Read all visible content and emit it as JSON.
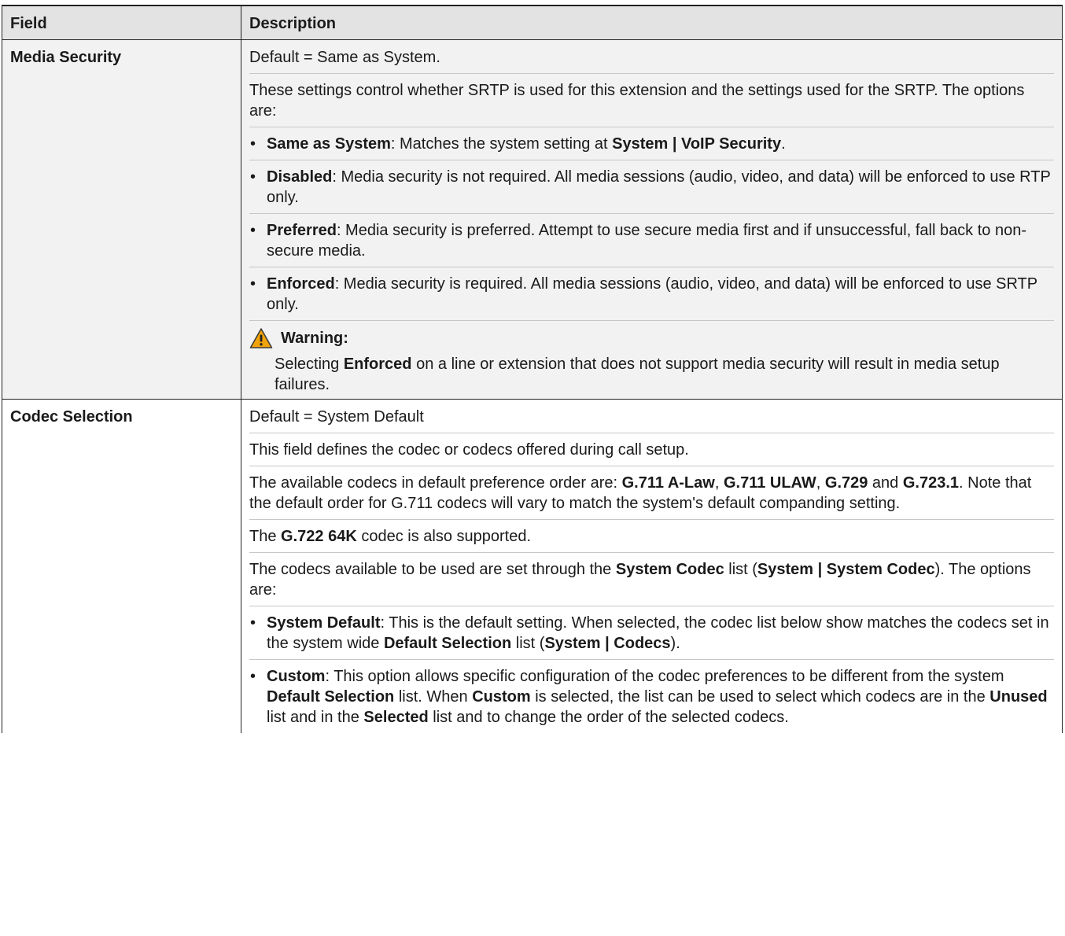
{
  "header": {
    "field": "Field",
    "description": "Description"
  },
  "rows": [
    {
      "field": "Media Security",
      "paras": [
        [
          {
            "t": "Default = Same as System."
          }
        ],
        [
          {
            "t": "These settings control whether SRTP is used for this extension and the settings used for the SRTP. The options are:"
          }
        ]
      ],
      "bullets": [
        [
          {
            "t": "Same as System",
            "b": true
          },
          {
            "t": ": Matches the system setting at "
          },
          {
            "t": "System | VoIP Security",
            "b": true
          },
          {
            "t": "."
          }
        ],
        [
          {
            "t": "Disabled",
            "b": true
          },
          {
            "t": ": Media security is not required. All media sessions (audio, video, and data) will be enforced to use RTP only."
          }
        ],
        [
          {
            "t": "Preferred",
            "b": true
          },
          {
            "t": ": Media security is preferred. Attempt to use secure media first and if unsuccessful, fall back to non-secure media."
          }
        ],
        [
          {
            "t": "Enforced",
            "b": true
          },
          {
            "t": ": Media security is required. All media sessions (audio, video, and data) will be enforced to use SRTP only."
          }
        ]
      ],
      "warning": {
        "title": "Warning:",
        "body": [
          {
            "t": "Selecting "
          },
          {
            "t": "Enforced",
            "b": true
          },
          {
            "t": " on a line or extension that does not support media security will result in media setup failures."
          }
        ]
      }
    },
    {
      "field": "Codec Selection",
      "paras": [
        [
          {
            "t": "Default = System Default"
          }
        ],
        [
          {
            "t": "This field defines the codec or codecs offered during call setup."
          }
        ],
        [
          {
            "t": "The available codecs in default preference order are: "
          },
          {
            "t": "G.711 A-Law",
            "b": true
          },
          {
            "t": ", "
          },
          {
            "t": "G.711 ULAW",
            "b": true
          },
          {
            "t": ", "
          },
          {
            "t": "G.729",
            "b": true
          },
          {
            "t": " and "
          },
          {
            "t": "G.723.1",
            "b": true
          },
          {
            "t": ". Note that the default order for G.711 codecs will vary to match the system's default companding setting."
          }
        ],
        [
          {
            "t": "The "
          },
          {
            "t": "G.722 64K",
            "b": true
          },
          {
            "t": " codec is also supported."
          }
        ],
        [
          {
            "t": "The codecs available to be used are set through the "
          },
          {
            "t": "System Codec",
            "b": true
          },
          {
            "t": " list ("
          },
          {
            "t": "System | System Codec",
            "b": true
          },
          {
            "t": "). The options are:"
          }
        ]
      ],
      "bullets": [
        [
          {
            "t": "System Default",
            "b": true
          },
          {
            "t": ": This is the default setting. When selected, the codec list below show matches the codecs set in the system wide "
          },
          {
            "t": "Default Selection",
            "b": true
          },
          {
            "t": " list ("
          },
          {
            "t": "System | Codecs",
            "b": true
          },
          {
            "t": ")."
          }
        ],
        [
          {
            "t": "Custom",
            "b": true
          },
          {
            "t": ": This option allows specific configuration of the codec preferences to be different from the system "
          },
          {
            "t": "Default Selection",
            "b": true
          },
          {
            "t": " list. When "
          },
          {
            "t": "Custom",
            "b": true
          },
          {
            "t": " is selected, the list can be used to select which codecs are in the "
          },
          {
            "t": "Unused",
            "b": true
          },
          {
            "t": " list and in the "
          },
          {
            "t": "Selected",
            "b": true
          },
          {
            "t": " list and to change the order of the selected codecs."
          }
        ]
      ]
    }
  ],
  "bullet_char": "•",
  "icons": {
    "warning": "warning-triangle-icon",
    "warning_color": "#f0a30a"
  }
}
